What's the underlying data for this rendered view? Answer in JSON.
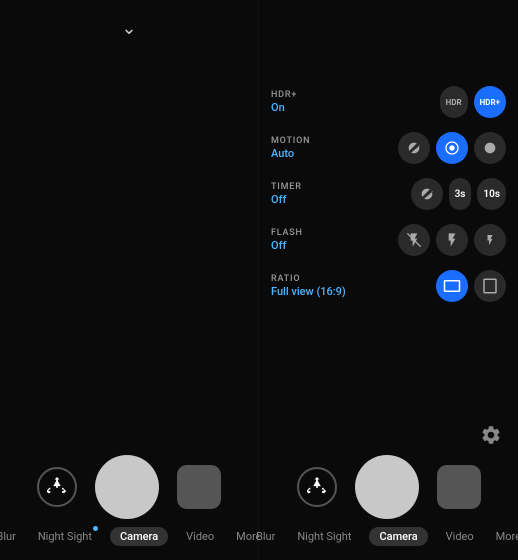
{
  "left_panel": {
    "chevron": "⌄",
    "controls": {
      "flip_label": "flip",
      "shutter_label": "shutter",
      "last_photo_label": "last photo"
    },
    "modes": [
      {
        "id": "blur",
        "label": "Blur",
        "active": false,
        "dot": false
      },
      {
        "id": "night-sight",
        "label": "Night Sight",
        "active": false,
        "dot": true
      },
      {
        "id": "camera",
        "label": "Camera",
        "active": true,
        "dot": false
      },
      {
        "id": "video",
        "label": "Video",
        "active": false,
        "dot": false
      },
      {
        "id": "more",
        "label": "More",
        "active": false,
        "dot": false
      }
    ]
  },
  "right_panel": {
    "settings": [
      {
        "id": "hdr",
        "label": "HDR+",
        "value": "On",
        "options": [
          {
            "id": "hdr-off",
            "icon": "HDR",
            "active": false
          },
          {
            "id": "hdr-on",
            "icon": "HDR+",
            "active": true
          }
        ]
      },
      {
        "id": "motion",
        "label": "MOTION",
        "value": "Auto",
        "options": [
          {
            "id": "motion-off",
            "icon": "⊘",
            "active": false
          },
          {
            "id": "motion-auto",
            "icon": "◎",
            "active": true
          },
          {
            "id": "motion-on",
            "icon": "●",
            "active": false
          }
        ]
      },
      {
        "id": "timer",
        "label": "TIMER",
        "value": "Off",
        "options": [
          {
            "id": "timer-off",
            "icon": "⊘",
            "active": false
          },
          {
            "id": "timer-3s",
            "text": "3s",
            "active": false
          },
          {
            "id": "timer-10s",
            "text": "10s",
            "active": false
          }
        ]
      },
      {
        "id": "flash",
        "label": "FLASH",
        "value": "Off",
        "options": [
          {
            "id": "flash-off",
            "icon": "✕",
            "active": false
          },
          {
            "id": "flash-auto",
            "icon": "⚡",
            "active": false
          },
          {
            "id": "flash-on",
            "icon": "⚡",
            "active": false
          }
        ]
      },
      {
        "id": "ratio",
        "label": "RATIO",
        "value": "Full view (16:9)",
        "options": [
          {
            "id": "ratio-169",
            "icon": "▭",
            "active": true
          },
          {
            "id": "ratio-43",
            "icon": "▯",
            "active": false
          }
        ]
      }
    ],
    "gear_label": "settings",
    "controls": {
      "flip_label": "flip",
      "shutter_label": "shutter",
      "last_photo_label": "last photo"
    },
    "modes": [
      {
        "id": "blur",
        "label": "Blur",
        "active": false,
        "dot": false
      },
      {
        "id": "night-sight",
        "label": "Night Sight",
        "active": false,
        "dot": false
      },
      {
        "id": "camera",
        "label": "Camera",
        "active": true,
        "dot": false
      },
      {
        "id": "video",
        "label": "Video",
        "active": false,
        "dot": false
      },
      {
        "id": "more",
        "label": "More",
        "active": false,
        "dot": false
      }
    ]
  },
  "colors": {
    "active_blue": "#1a6dff",
    "value_blue": "#4db6ff",
    "inactive_bg": "#2a2a2a",
    "text_primary": "#fff",
    "text_secondary": "#888"
  }
}
